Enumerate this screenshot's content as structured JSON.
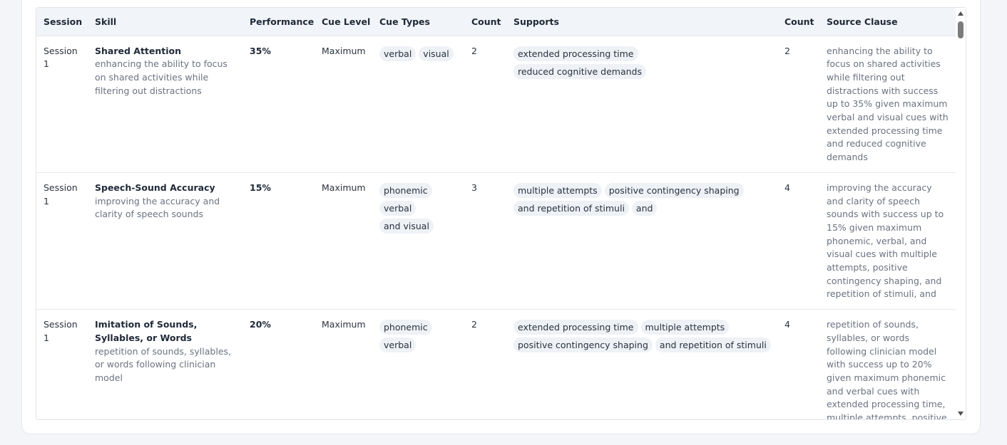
{
  "columns": [
    "Session",
    "Skill",
    "Performance",
    "Cue Level",
    "Cue Types",
    "Count",
    "Supports",
    "Count",
    "Source Clause"
  ],
  "rows": [
    {
      "session": "Session 1",
      "skill_name": "Shared Attention",
      "skill_desc": "enhancing the ability to focus on shared activities while filtering out distractions",
      "performance": "35%",
      "cue_level": "Maximum",
      "cue_types": [
        "verbal",
        "visual"
      ],
      "cue_count": "2",
      "supports": [
        "extended processing time",
        "reduced cognitive demands"
      ],
      "support_count": "2",
      "source_clause": "enhancing the ability to focus on shared activities while filtering out distractions with success up to 35% given maximum verbal and visual cues with extended processing time and reduced cognitive demands"
    },
    {
      "session": "Session 1",
      "skill_name": "Speech-Sound Accuracy",
      "skill_desc": "improving the accuracy and clarity of speech sounds",
      "performance": "15%",
      "cue_level": "Maximum",
      "cue_types": [
        "phonemic",
        "verbal",
        "and visual"
      ],
      "cue_count": "3",
      "supports": [
        "multiple attempts",
        "positive contingency shaping",
        "and repetition of stimuli",
        "and"
      ],
      "support_count": "4",
      "source_clause": "improving the accuracy and clarity of speech sounds with success up to 15% given maximum phonemic, verbal, and visual cues with multiple attempts, positive contingency shaping, and repetition of stimuli, and"
    },
    {
      "session": "Session 1",
      "skill_name": "Imitation of Sounds, Syllables, or Words",
      "skill_desc": "repetition of sounds, syllables, or words following clinician model",
      "performance": "20%",
      "cue_level": "Maximum",
      "cue_types": [
        "phonemic",
        "verbal"
      ],
      "cue_count": "2",
      "supports": [
        "extended processing time",
        "multiple attempts",
        "positive contingency shaping",
        "and repetition of stimuli"
      ],
      "support_count": "4",
      "source_clause": "repetition of sounds, syllables, or words following clinician model with success up to 20% given maximum phonemic and verbal cues with extended processing time, multiple attempts, positive contingency shaping, and repetition of stimuli"
    }
  ]
}
